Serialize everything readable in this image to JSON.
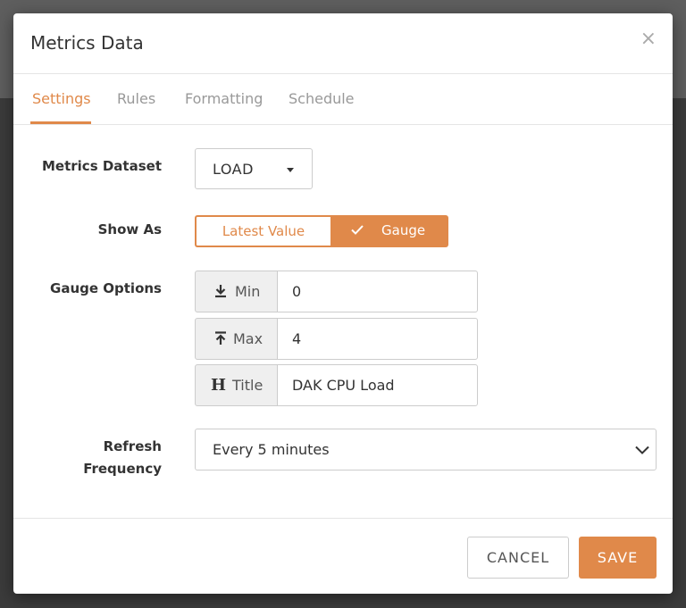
{
  "modal": {
    "title": "Metrics Data",
    "close_label": "×"
  },
  "tabs": [
    {
      "label": "Settings",
      "active": true
    },
    {
      "label": "Rules",
      "active": false
    },
    {
      "label": "Formatting",
      "active": false
    },
    {
      "label": "Schedule",
      "active": false
    }
  ],
  "form": {
    "dataset": {
      "label": "Metrics Dataset",
      "value": "LOAD"
    },
    "show_as": {
      "label": "Show As",
      "options": [
        {
          "label": "Latest Value",
          "selected": false
        },
        {
          "label": "Gauge",
          "selected": true
        }
      ]
    },
    "gauge_options": {
      "label": "Gauge Options",
      "min": {
        "label": "Min",
        "icon": "arrow-to-bottom-icon",
        "value": "0"
      },
      "max": {
        "label": "Max",
        "icon": "arrow-to-top-icon",
        "value": "4"
      },
      "title": {
        "label": "Title",
        "icon": "heading-icon",
        "value": "DAK CPU Load"
      }
    },
    "refresh": {
      "label_line1": "Refresh",
      "label_line2": "Frequency",
      "value": "Every 5 minutes"
    }
  },
  "footer": {
    "cancel_label": "CANCEL",
    "save_label": "SAVE"
  },
  "colors": {
    "accent": "#e0894a"
  }
}
